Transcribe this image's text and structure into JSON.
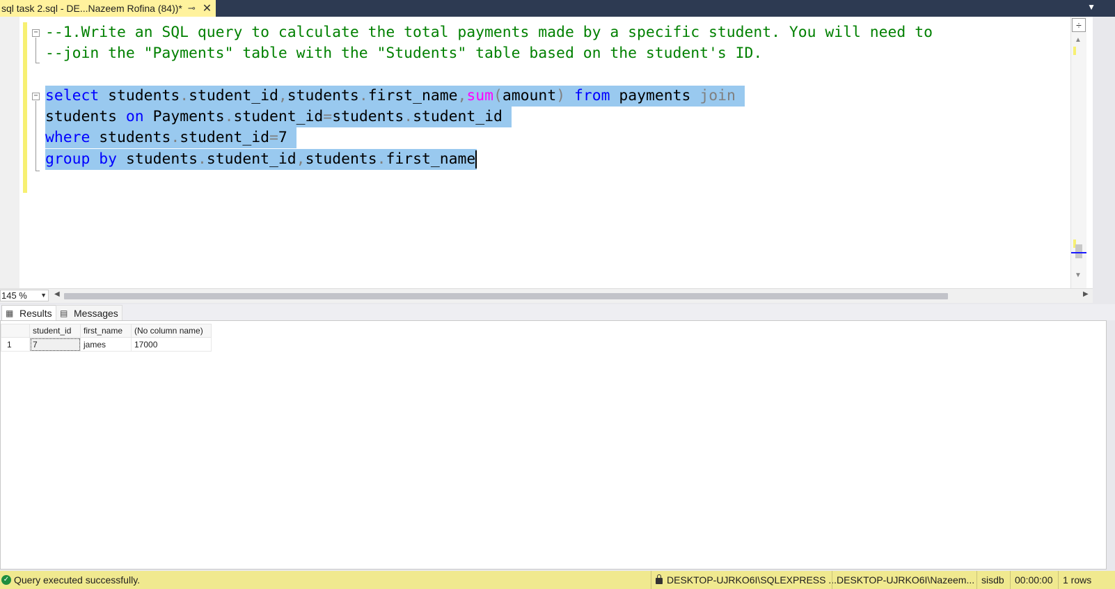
{
  "tab": {
    "title": "sql task 2.sql - DE...Nazeem Rofina (84))*",
    "pin": "⊸",
    "close": "✕"
  },
  "editor": {
    "comment_line1": "--1.Write an SQL query to calculate the total payments made by a specific student. You will need to",
    "comment_line2": "--join the \"Payments\" table with the \"Students\" table based on the student's ID.",
    "query": {
      "l1": {
        "kw_select": "select",
        "t1": "students",
        "d1": ".",
        "t2": "student_id",
        "c1": ",",
        "t3": "students",
        "d2": ".",
        "t4": "first_name",
        "c2": ",",
        "fn_sum": "sum",
        "p1": "(",
        "t5": "amount",
        "p2": ")",
        "kw_from": "from",
        "t6": "payments",
        "kw_join": "join"
      },
      "l2": {
        "t1": "students",
        "kw_on": "on",
        "t2": "Payments",
        "d1": ".",
        "t3": "student_id",
        "eq": "=",
        "t4": "students",
        "d2": ".",
        "t5": "student_id"
      },
      "l3": {
        "kw_where": "where",
        "t1": "students",
        "d1": ".",
        "t2": "student_id",
        "eq": "=",
        "t3": "7"
      },
      "l4": {
        "kw_group": "group",
        "kw_by": "by",
        "t1": "students",
        "d1": ".",
        "t2": "student_id",
        "c1": ",",
        "t3": "students",
        "d2": ".",
        "t4": "first_name"
      }
    }
  },
  "zoom": {
    "value": "145 %"
  },
  "results_tabs": {
    "results": "Results",
    "messages": "Messages"
  },
  "grid": {
    "columns": [
      "student_id",
      "first_name",
      "(No column name)"
    ],
    "rows": [
      {
        "num": "1",
        "student_id": "7",
        "first_name": "james",
        "total": "17000"
      }
    ]
  },
  "status": {
    "message": "Query executed successfully.",
    "server": "DESKTOP-UJRKO6I\\SQLEXPRESS ...",
    "user": "DESKTOP-UJRKO6I\\Nazeem...",
    "database": "sisdb",
    "time": "00:00:00",
    "rows": "1 rows"
  },
  "colors": {
    "tab_active": "#fff29d",
    "status_bar": "#f0e98f",
    "selection": "#99c9ef",
    "comment": "#008000",
    "keyword": "#0000ff",
    "function": "#ff00ff"
  },
  "icons": [
    "pin-icon",
    "close-icon",
    "chevron-down-icon",
    "collapse-icon",
    "split-icon",
    "grid-icon",
    "messages-icon",
    "check-circle-icon",
    "lock-icon"
  ]
}
